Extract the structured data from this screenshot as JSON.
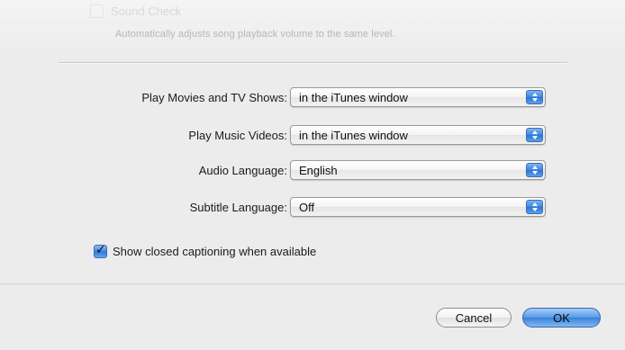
{
  "top": {
    "sound_check_label": "Sound Check",
    "sound_check_description": "Automatically adjusts song playback volume to the same level."
  },
  "settings": [
    {
      "label": "Play Movies and TV Shows:",
      "value": "in the iTunes window"
    },
    {
      "label": "Play Music Videos:",
      "value": "in the iTunes window"
    },
    {
      "label": "Audio Language:",
      "value": "English"
    },
    {
      "label": "Subtitle Language:",
      "value": "Off"
    }
  ],
  "closed_captioning": {
    "label": "Show closed captioning when available",
    "checked": true
  },
  "buttons": {
    "cancel": "Cancel",
    "ok": "OK"
  },
  "colors": {
    "accent": "#3c86e0",
    "background": "#ececec"
  }
}
